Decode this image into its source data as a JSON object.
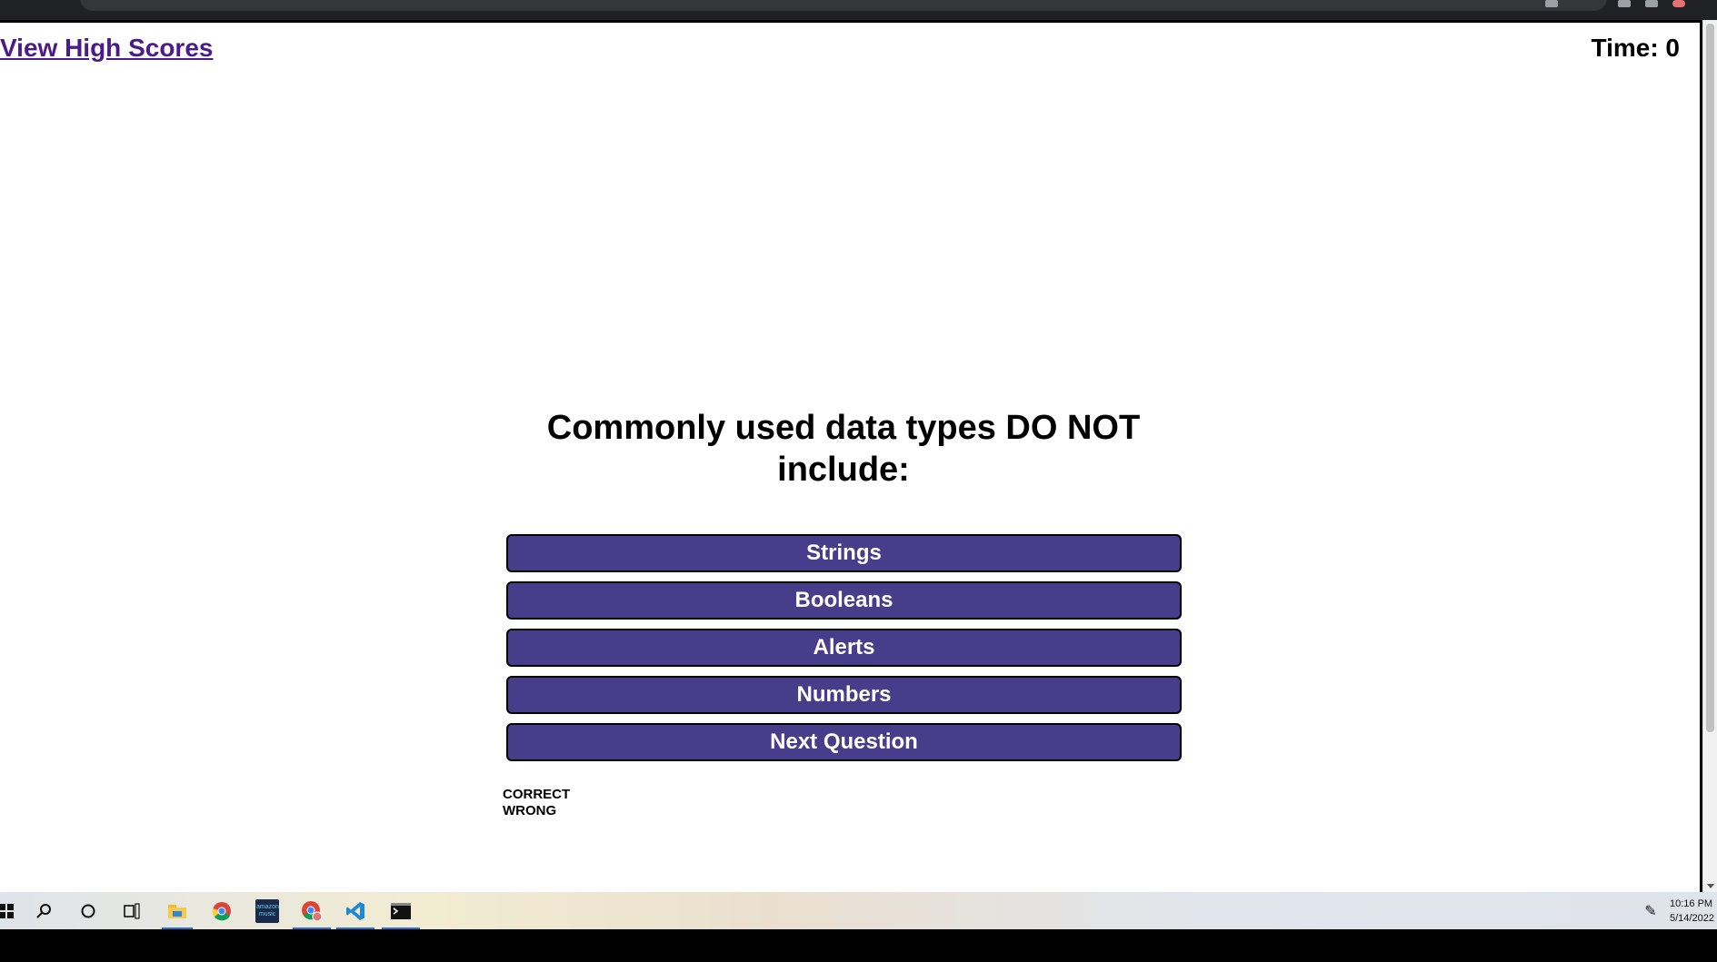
{
  "header": {
    "high_scores_label": "View High Scores",
    "timer_label": "Time: 0"
  },
  "quiz": {
    "question": "Commonly used data types DO NOT include:",
    "answers": [
      "Strings",
      "Booleans",
      "Alerts",
      "Numbers"
    ],
    "next_label": "Next Question",
    "feedback_correct": "CORRECT",
    "feedback_wrong": "WRONG"
  },
  "colors": {
    "button_bg": "#483d8b",
    "link": "#4b1a8c"
  },
  "taskbar": {
    "icons": [
      "windows-start-icon",
      "search-icon",
      "cortana-icon",
      "task-view-icon",
      "file-explorer-icon",
      "chrome-icon",
      "amazon-music-icon",
      "chrome-profile-icon",
      "vscode-icon",
      "terminal-icon"
    ],
    "amazon_music_label": "amazon music",
    "clock_time": "10:16 PM",
    "clock_date": "5/14/2022"
  }
}
